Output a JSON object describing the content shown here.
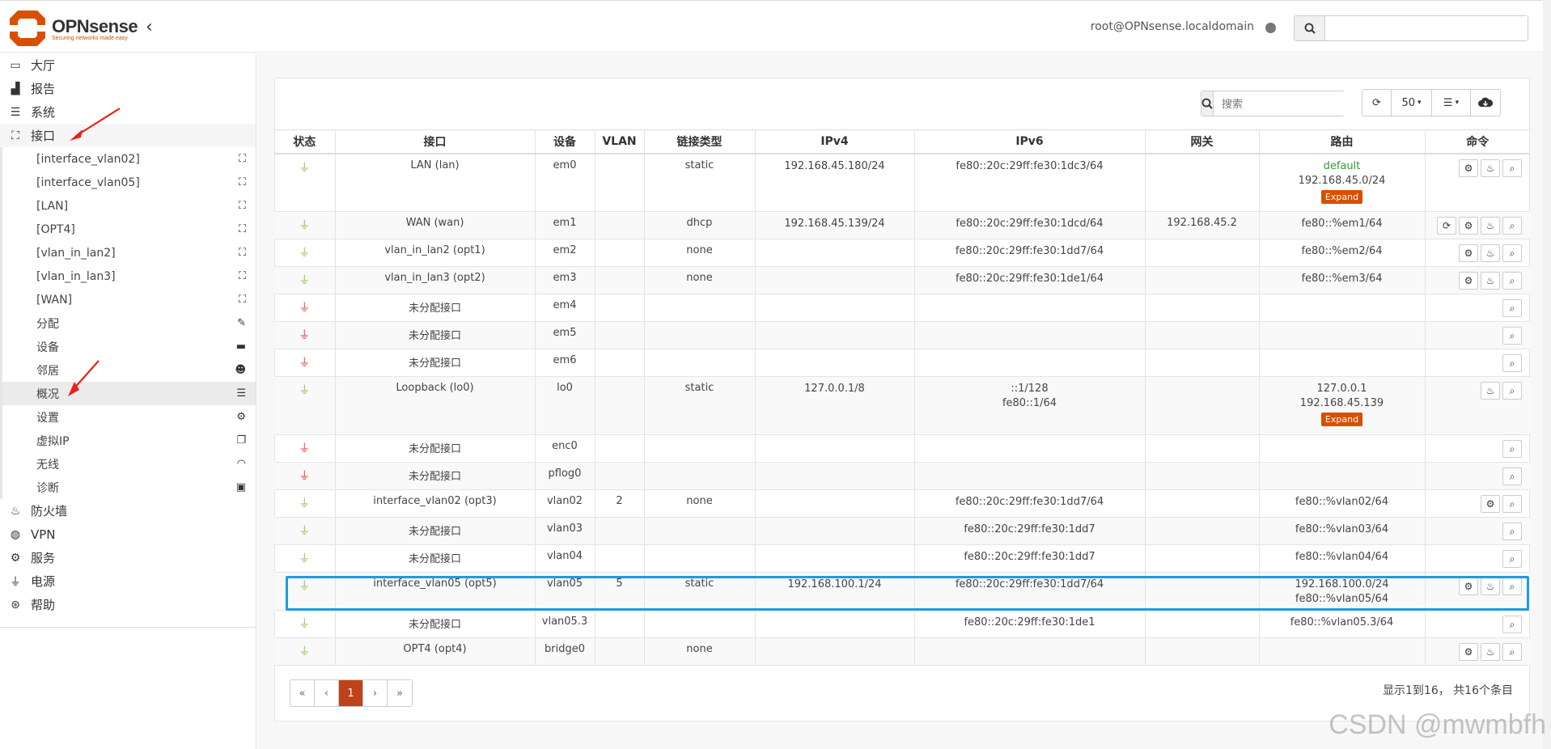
{
  "header": {
    "logo_title": "OPNsense",
    "logo_tagline": "Securing networks made easy",
    "user": "root@OPNsense.localdomain",
    "search_placeholder": ""
  },
  "sidebar": {
    "top_items": [
      {
        "label": "大厅",
        "icon": "laptop-icon"
      },
      {
        "label": "报告",
        "icon": "chart-icon"
      },
      {
        "label": "系统",
        "icon": "server-icon"
      },
      {
        "label": "接口",
        "icon": "sitemap-icon"
      }
    ],
    "sub_items": [
      {
        "label": "[interface_vlan02]",
        "icon": "sitemap-icon"
      },
      {
        "label": "[interface_vlan05]",
        "icon": "sitemap-icon"
      },
      {
        "label": "[LAN]",
        "icon": "sitemap-icon"
      },
      {
        "label": "[OPT4]",
        "icon": "sitemap-icon"
      },
      {
        "label": "[vlan_in_lan2]",
        "icon": "sitemap-icon"
      },
      {
        "label": "[vlan_in_lan3]",
        "icon": "sitemap-icon"
      },
      {
        "label": "[WAN]",
        "icon": "sitemap-icon"
      },
      {
        "label": "分配",
        "icon": "pencil-icon"
      },
      {
        "label": "设备",
        "icon": "archive-icon"
      },
      {
        "label": "邻居",
        "icon": "users-icon"
      },
      {
        "label": "概况",
        "icon": "server-icon"
      },
      {
        "label": "设置",
        "icon": "cogs-icon"
      },
      {
        "label": "虚拟IP",
        "icon": "clone-icon"
      },
      {
        "label": "无线",
        "icon": "wifi-icon"
      },
      {
        "label": "诊断",
        "icon": "medkit-icon"
      }
    ],
    "bottom_items": [
      {
        "label": "防火墙",
        "icon": "fire-icon"
      },
      {
        "label": "VPN",
        "icon": "globe-icon"
      },
      {
        "label": "服务",
        "icon": "gear-icon"
      },
      {
        "label": "电源",
        "icon": "plug-icon"
      },
      {
        "label": "帮助",
        "icon": "lifebuoy-icon"
      }
    ]
  },
  "toolbar": {
    "search_placeholder": "搜索",
    "page_size": "50"
  },
  "table": {
    "headers": [
      "状态",
      "接口",
      "设备",
      "VLAN",
      "链接类型",
      "IPv4",
      "IPv6",
      "网关",
      "路由",
      "命令"
    ],
    "rows": [
      {
        "status": "up",
        "iface": "LAN (lan)",
        "device": "em0",
        "vlan": "",
        "link": "static",
        "ipv4": [
          "192.168.45.180/24"
        ],
        "ipv6": [
          "fe80::20c:29ff:fe30:1dc3/64"
        ],
        "gw": "",
        "routes": [
          "default",
          "192.168.45.0/24"
        ],
        "route_default": true,
        "expand": true,
        "cmds": [
          "gear",
          "fire",
          "search"
        ]
      },
      {
        "status": "up",
        "iface": "WAN (wan)",
        "device": "em1",
        "vlan": "",
        "link": "dhcp",
        "ipv4": [
          "192.168.45.139/24"
        ],
        "ipv6": [
          "fe80::20c:29ff:fe30:1dcd/64"
        ],
        "gw": "192.168.45.2",
        "routes": [
          "fe80::%em1/64"
        ],
        "cmds": [
          "reload",
          "gear",
          "fire",
          "search"
        ]
      },
      {
        "status": "up",
        "iface": "vlan_in_lan2 (opt1)",
        "device": "em2",
        "vlan": "",
        "link": "none",
        "ipv4": [],
        "ipv6": [
          "fe80::20c:29ff:fe30:1dd7/64"
        ],
        "gw": "",
        "routes": [
          "fe80::%em2/64"
        ],
        "cmds": [
          "gear",
          "fire",
          "search"
        ]
      },
      {
        "status": "up",
        "iface": "vlan_in_lan3 (opt2)",
        "device": "em3",
        "vlan": "",
        "link": "none",
        "ipv4": [],
        "ipv6": [
          "fe80::20c:29ff:fe30:1de1/64"
        ],
        "gw": "",
        "routes": [
          "fe80::%em3/64"
        ],
        "cmds": [
          "gear",
          "fire",
          "search"
        ]
      },
      {
        "status": "down",
        "iface": "未分配接口",
        "device": "em4",
        "vlan": "",
        "link": "",
        "ipv4": [],
        "ipv6": [],
        "gw": "",
        "routes": [],
        "cmds": [
          "search"
        ]
      },
      {
        "status": "down",
        "iface": "未分配接口",
        "device": "em5",
        "vlan": "",
        "link": "",
        "ipv4": [],
        "ipv6": [],
        "gw": "",
        "routes": [],
        "cmds": [
          "search"
        ]
      },
      {
        "status": "down",
        "iface": "未分配接口",
        "device": "em6",
        "vlan": "",
        "link": "",
        "ipv4": [],
        "ipv6": [],
        "gw": "",
        "routes": [],
        "cmds": [
          "search"
        ]
      },
      {
        "status": "up",
        "iface": "Loopback (lo0)",
        "device": "lo0",
        "vlan": "",
        "link": "static",
        "ipv4": [
          "127.0.0.1/8"
        ],
        "ipv6": [
          "::1/128",
          "fe80::1/64"
        ],
        "gw": "",
        "routes": [
          "127.0.0.1",
          "192.168.45.139"
        ],
        "expand": true,
        "cmds": [
          "fire",
          "search"
        ]
      },
      {
        "status": "down",
        "iface": "未分配接口",
        "device": "enc0",
        "vlan": "",
        "link": "",
        "ipv4": [],
        "ipv6": [],
        "gw": "",
        "routes": [],
        "cmds": [
          "search"
        ]
      },
      {
        "status": "down",
        "iface": "未分配接口",
        "device": "pflog0",
        "vlan": "",
        "link": "",
        "ipv4": [],
        "ipv6": [],
        "gw": "",
        "routes": [],
        "cmds": [
          "search"
        ]
      },
      {
        "status": "up",
        "iface": "interface_vlan02 (opt3)",
        "device": "vlan02",
        "vlan": "2",
        "link": "none",
        "ipv4": [],
        "ipv6": [
          "fe80::20c:29ff:fe30:1dd7/64"
        ],
        "gw": "",
        "routes": [
          "fe80::%vlan02/64"
        ],
        "cmds": [
          "gear",
          "search"
        ]
      },
      {
        "status": "up",
        "iface": "未分配接口",
        "device": "vlan03",
        "vlan": "",
        "link": "",
        "ipv4": [],
        "ipv6": [
          "fe80::20c:29ff:fe30:1dd7"
        ],
        "gw": "",
        "routes": [
          "fe80::%vlan03/64"
        ],
        "cmds": [
          "search"
        ]
      },
      {
        "status": "up",
        "iface": "未分配接口",
        "device": "vlan04",
        "vlan": "",
        "link": "",
        "ipv4": [],
        "ipv6": [
          "fe80::20c:29ff:fe30:1dd7"
        ],
        "gw": "",
        "routes": [
          "fe80::%vlan04/64"
        ],
        "cmds": [
          "search"
        ]
      },
      {
        "status": "up",
        "iface": "interface_vlan05 (opt5)",
        "device": "vlan05",
        "vlan": "5",
        "link": "static",
        "ipv4": [
          "192.168.100.1/24"
        ],
        "ipv6": [
          "fe80::20c:29ff:fe30:1dd7/64"
        ],
        "gw": "",
        "routes": [
          "192.168.100.0/24",
          "fe80::%vlan05/64"
        ],
        "cmds": [
          "gear",
          "fire",
          "search"
        ]
      },
      {
        "status": "up",
        "iface": "未分配接口",
        "device": "vlan05.3",
        "vlan": "",
        "link": "",
        "ipv4": [],
        "ipv6": [
          "fe80::20c:29ff:fe30:1de1"
        ],
        "gw": "",
        "routes": [
          "fe80::%vlan05.3/64"
        ],
        "cmds": [
          "search"
        ]
      },
      {
        "status": "up",
        "iface": "OPT4 (opt4)",
        "device": "bridge0",
        "vlan": "",
        "link": "none",
        "ipv4": [],
        "ipv6": [],
        "gw": "",
        "routes": [],
        "cmds": [
          "gear",
          "fire",
          "search"
        ]
      }
    ],
    "expand_label": "Expand"
  },
  "pager": {
    "first": "«",
    "prev": "‹",
    "current": "1",
    "next": "›",
    "last": "»",
    "info": "显示1到16， 共16个条目"
  },
  "watermark": "CSDN @mwmbfh",
  "colors": {
    "accent": "#d94f00",
    "up": "#8bc34a",
    "down": "#e53935",
    "highlight": "#1e9be0"
  }
}
